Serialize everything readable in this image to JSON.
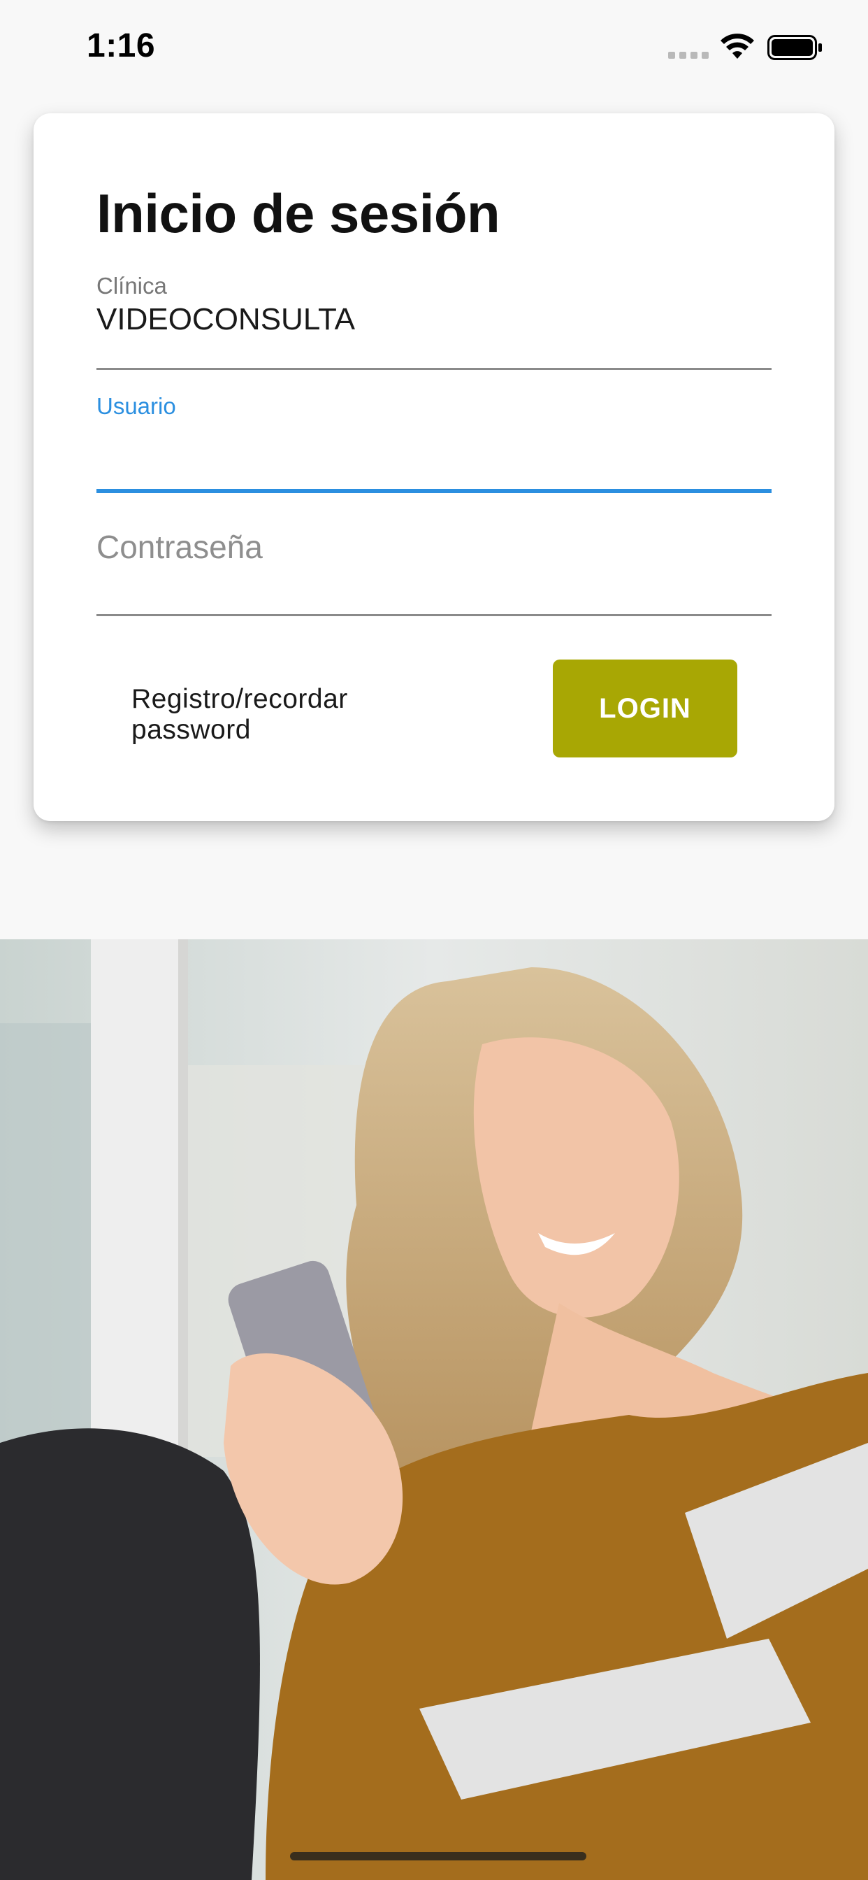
{
  "status_bar": {
    "time": "1:16"
  },
  "login": {
    "title": "Inicio de sesión",
    "clinic_label": "Clínica",
    "clinic_value": "VIDEOCONSULTA",
    "user_label": "Usuario",
    "user_value": "",
    "password_placeholder": "Contraseña",
    "password_value": "",
    "register_link": "Registro/recordar password",
    "login_button": "LOGIN"
  },
  "colors": {
    "accent_blue": "#2b8fe0",
    "button_olive": "#a8a704",
    "background": "#f8f8f8"
  },
  "icons": [
    "signal-icon",
    "wifi-icon",
    "battery-icon"
  ],
  "image": {
    "description": "hero photo"
  }
}
